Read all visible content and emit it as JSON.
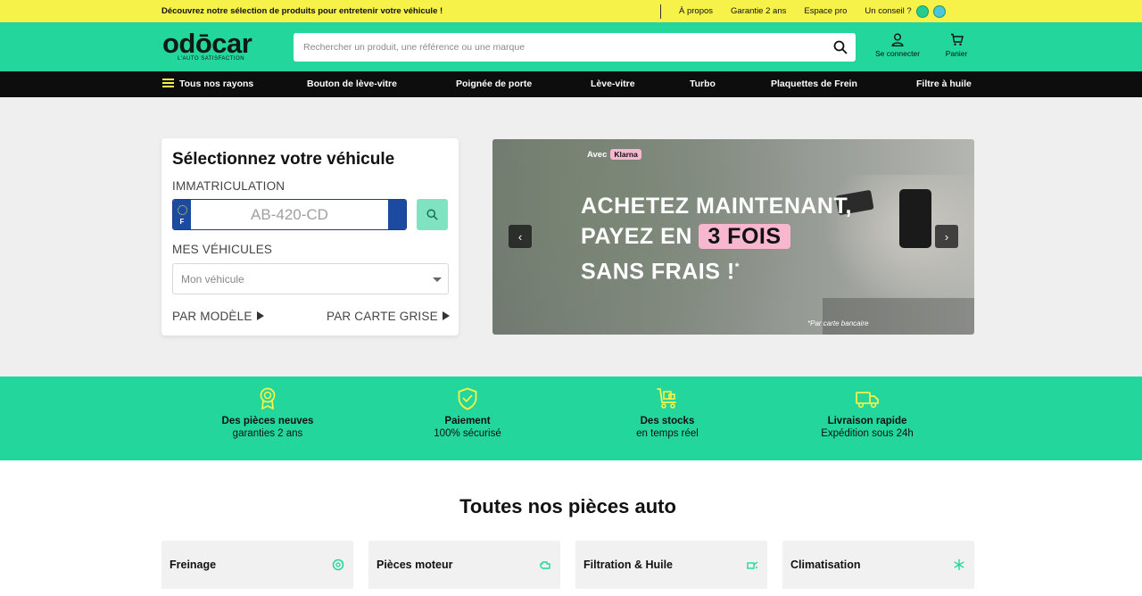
{
  "topbar": {
    "promo": "Découvrez notre sélection de produits pour entretenir votre véhicule !",
    "links": [
      "À propos",
      "Garantie 2 ans",
      "Espace pro"
    ],
    "advice": "Un conseil ?"
  },
  "header": {
    "logo": "odōcar",
    "tagline": "L'AUTO SATISFACTION",
    "search_placeholder": "Rechercher un produit, une référence ou une marque",
    "login": "Se connecter",
    "cart": "Panier"
  },
  "nav": {
    "all": "Tous nos rayons",
    "items": [
      "Bouton de lève-vitre",
      "Poignée de porte",
      "Lève-vitre",
      "Turbo",
      "Plaquettes de Frein",
      "Filtre à huile"
    ]
  },
  "vehicle": {
    "title": "Sélectionnez votre véhicule",
    "plate_label": "IMMATRICULATION",
    "plate_country": "F",
    "plate_placeholder": "AB-420-CD",
    "my_vehicles_label": "MES VÉHICULES",
    "select_value": "Mon véhicule",
    "by_model": "PAR MODÈLE",
    "by_card": "PAR CARTE GRISE"
  },
  "banner": {
    "avec": "Avec",
    "klarna": "Klarna",
    "line1": "ACHETEZ MAINTENANT,",
    "line2a": "PAYEZ EN",
    "line2b": "3 FOIS",
    "line3": "SANS FRAIS !",
    "asterisk": "*",
    "note": "*Par carte bancaire",
    "prev": "‹",
    "next": "›"
  },
  "features": [
    {
      "title": "Des pièces neuves",
      "subtitle": "garanties 2 ans"
    },
    {
      "title": "Paiement",
      "subtitle": "100% sécurisé"
    },
    {
      "title": "Des stocks",
      "subtitle": "en temps réel"
    },
    {
      "title": "Livraison rapide",
      "subtitle": "Expédition sous 24h"
    }
  ],
  "section": {
    "title": "Toutes nos pièces auto",
    "categories": [
      "Freinage",
      "Pièces moteur",
      "Filtration & Huile",
      "Climatisation"
    ]
  },
  "colors": {
    "brand_green": "#23d69b",
    "yellow": "#f6f24a",
    "pink": "#f7b7cf",
    "nav_black": "#0d0d0d"
  }
}
